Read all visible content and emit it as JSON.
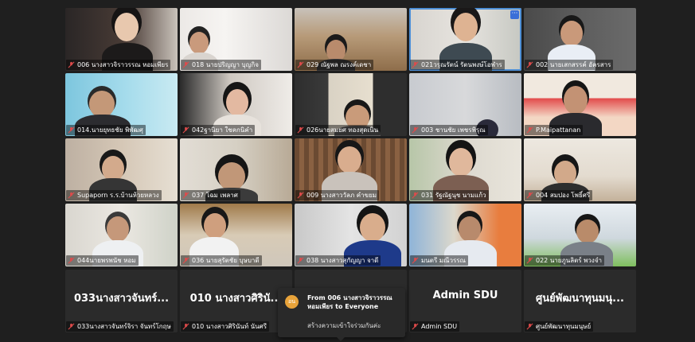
{
  "tiles": [
    {
      "label": "006 นางสาวจิราวรรณ หอมเพียร"
    },
    {
      "label": "018 นายปริญญา บุญกิจ"
    },
    {
      "label": "029 ณัฐพล ณรงค์เดชา"
    },
    {
      "label": "021วรุณรัตน์ รัตนพงษ์โอฬาร"
    },
    {
      "label": "002 นายเสกสรรค์ อัครสาร"
    },
    {
      "label": "014.นายยุทธชัย พิพัฒศุ"
    },
    {
      "label": "042ฐานิยา ใชคกนิคำ"
    },
    {
      "label": "026นายสมยศ ทองสุดเนิน"
    },
    {
      "label": "003 ชานชัย เพชรพิรุณ"
    },
    {
      "label": "P.Maipattanan"
    },
    {
      "label": "Supaporn ร.ร.บ้านห้วยหลวง"
    },
    {
      "label": "037 โฉม เพลาศ"
    },
    {
      "label": "009 นางสาววัลภ คำขยม"
    },
    {
      "label": "031 รัฐณัฐนุช นามแก้ว"
    },
    {
      "label": "004 สมปอง โพธิ์ศรี"
    },
    {
      "label": "044นายพรพนัช หอม"
    },
    {
      "label": "036 นายสุรัตชัย บุษบาดี"
    },
    {
      "label": "038 นางสาวสุกัญญา จาดี"
    },
    {
      "label": "มนตรี มณีวรรณ"
    },
    {
      "label": "022 นายภูนลิตร์ พวงจำ"
    },
    {
      "label": "033นางสาวจันทร์จิรา จันทร์โกฤษ",
      "bigname": "033นางสาวจันทร์..."
    },
    {
      "label": "010 นางสาวศิรินันท์ นันศรี",
      "bigname": "010 นางสาวศิรินั..."
    },
    {
      "label": "",
      "bigname": ""
    },
    {
      "label": "Admin SDU",
      "bigname": "Admin SDU"
    },
    {
      "label": "ศูนย์พัฒนาทุนมนุษย์",
      "bigname": "ศูนย์พัฒนาทุนมนุ..."
    }
  ],
  "toast": {
    "avatar": "อน",
    "from": "From 006 นางสาวจิราวรรณ หอมเพียร to Everyone",
    "message": "สร้างความเข้าใจร่วมกันค่ะ"
  },
  "tile_more_button": "···",
  "icons": [
    "mic-muted-icon",
    "more-options-icon"
  ]
}
